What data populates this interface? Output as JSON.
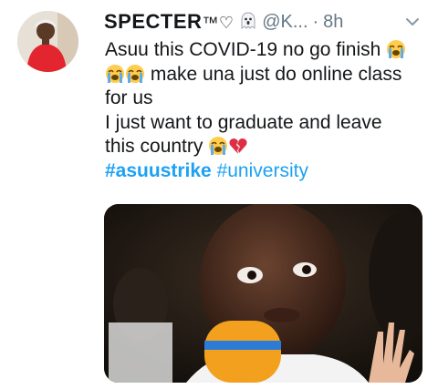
{
  "tweet": {
    "display_name": "SPECTER",
    "name_suffix": "™♡",
    "handle": "@K...",
    "separator": "·",
    "timestamp": "8h",
    "line1": "Asuu this COVID-19 no go finish",
    "line2": " make una just do online class",
    "line3": "for us",
    "line4": "I just want to graduate and leave",
    "line5": "this country",
    "hashtag1": "#asuustrike",
    "hashtag2": "#university",
    "icons": {
      "name_badge": "ghost-icon",
      "emoji_cry": "loudly-crying-face-icon",
      "emoji_heart": "broken-heart-icon",
      "menu": "chevron-down-icon"
    },
    "colors": {
      "text": "#14171a",
      "secondary": "#657786",
      "link": "#1da1f2"
    }
  }
}
